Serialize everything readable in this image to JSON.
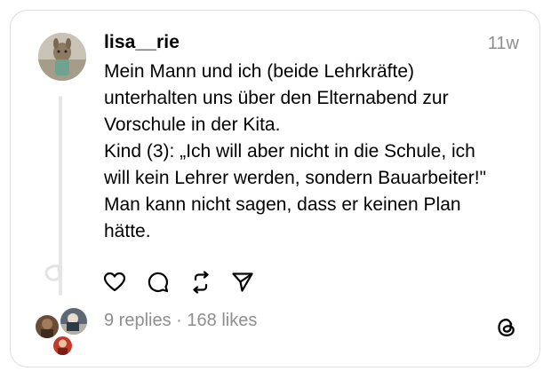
{
  "post": {
    "username": "lisa__rie",
    "time": "11w",
    "text": "Mein Mann und ich (beide Lehrkräfte)\nunterhalten uns über den Elternabend zur\nVorschule in der Kita.\nKind (3): „Ich will aber nicht in die Schule, ich\nwill kein Lehrer werden, sondern Bauarbeiter!\"\nMan kann nicht sagen, dass er keinen Plan\nhätte."
  },
  "stats": {
    "replies": "9 replies",
    "separator": " · ",
    "likes": "168 likes"
  },
  "icons": {
    "like": "heart-icon",
    "reply": "comment-icon",
    "repost": "repost-icon",
    "share": "send-icon",
    "brand": "threads-logo-icon"
  },
  "colors": {
    "text": "#000000",
    "muted": "#8e8e8e",
    "border": "#dedede",
    "thread_line": "#e6e6e6"
  }
}
